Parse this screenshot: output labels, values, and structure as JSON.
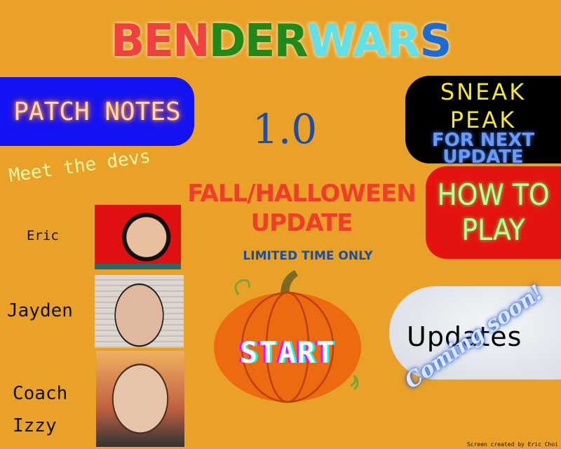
{
  "title": {
    "parts": [
      "BEN",
      "DER",
      "WAR",
      "S"
    ],
    "colors": [
      "#f04040",
      "#1f8a1a",
      "#5fe0ea",
      "#1b6bd8"
    ]
  },
  "patch_notes": "PATCH NOTES",
  "version": "1.0",
  "sneak_peak": {
    "line1": "SNEAK",
    "line2": "PEAK",
    "line3": "FOR NEXT",
    "line4": "UPDATE"
  },
  "how_to_play": {
    "line1": "HOW TO",
    "line2": "PLAY"
  },
  "meet_devs": "Meet the devs",
  "event": {
    "line1": "FALL/HALLOWEEN",
    "line2": "UPDATE",
    "note": "LIMITED TIME ONLY"
  },
  "start": "START",
  "updates": {
    "label": "Updates",
    "overlay": "Coming soon!"
  },
  "devs": [
    {
      "name": "Eric"
    },
    {
      "name": "Jayden"
    },
    {
      "name": "Coach",
      "name2": "Izzy"
    }
  ],
  "credit": "Screen created by Eric Choi"
}
